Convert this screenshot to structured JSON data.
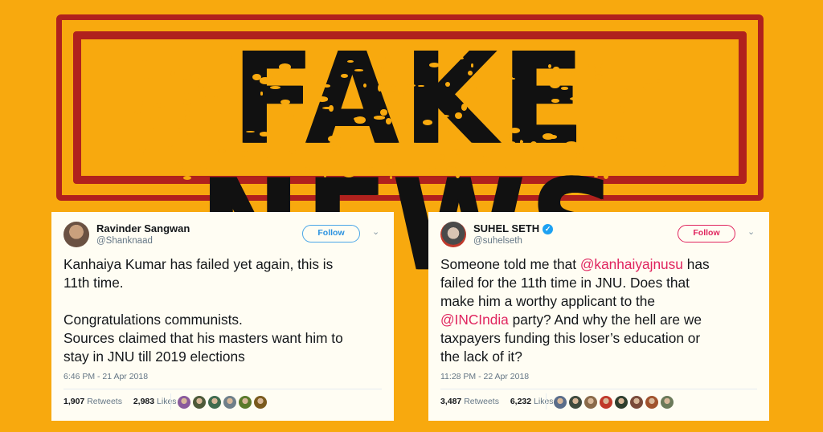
{
  "banner": {
    "text": "FAKE NEWS"
  },
  "colors": {
    "background": "#f8a90e",
    "stamp_red": "#b0211d",
    "follow_blue": "#2b92e0",
    "follow_red": "#e0245e",
    "mention_red": "#e0245e"
  },
  "tweets": [
    {
      "name": "Ravinder Sangwan",
      "handle": "@Shanknaad",
      "verified": false,
      "follow_label": "Follow",
      "text": "Kanhaiya Kumar has failed yet again, this is\n11th time.\n\nCongratulations communists.\nSources claimed that his masters want him to\nstay in JNU till 2019 elections",
      "timestamp": "6:46 PM - 21 Apr 2018",
      "retweets_count": "1,907",
      "retweets_label": "Retweets",
      "likes_count": "2,983",
      "likes_label": "Likes",
      "liker_avatars": [
        "#8a5a9c",
        "#4d5a3a",
        "#3f6b4f",
        "#6f7f8a",
        "#5a7a2c",
        "#7a5a1e"
      ]
    },
    {
      "name": "SUHEL SETH",
      "handle": "@suhelseth",
      "verified": true,
      "follow_label": "Follow",
      "text_parts": [
        {
          "t": "Someone told me that "
        },
        {
          "t": "@kanhaiyajnusu",
          "mention": true
        },
        {
          "t": " has\nfailed for the 11th time in JNU. Does that\nmake him a worthy applicant to the\n"
        },
        {
          "t": "@INCIndia",
          "mention": true
        },
        {
          "t": " party? And why the hell are we\ntaxpayers funding this loser’s education or\nthe lack of it?"
        }
      ],
      "timestamp": "11:28 PM - 22 Apr 2018",
      "retweets_count": "3,487",
      "retweets_label": "Retweets",
      "likes_count": "6,232",
      "likes_label": "Likes",
      "liker_avatars": [
        "#5a6d8a",
        "#3e4a3e",
        "#8a6a4a",
        "#c0392b",
        "#2e3e2e",
        "#7a4a3a",
        "#a0522d",
        "#6b7a5a"
      ]
    }
  ]
}
